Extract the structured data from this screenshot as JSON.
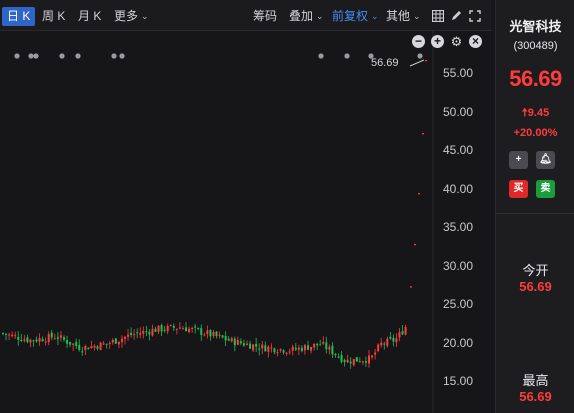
{
  "toolbar": {
    "tabs": [
      "日 K",
      "周 K",
      "月 K"
    ],
    "more": "更多",
    "chips": "筹码",
    "overlay": "叠加",
    "adjust": "前复权",
    "other": "其他"
  },
  "chart": {
    "current_price_tag": "56.69",
    "y_axis_labels": [
      "55.00",
      "50.00",
      "45.00",
      "40.00",
      "35.00",
      "30.00",
      "25.00",
      "20.00",
      "15.00"
    ],
    "colors": {
      "up": "#ff3b3b",
      "down": "#1fbf54",
      "background": "#161618"
    }
  },
  "chart_data": {
    "type": "candlestick",
    "ylim": [
      13,
      57
    ],
    "y_ticks": [
      55,
      50,
      45,
      40,
      35,
      30,
      25,
      20,
      15
    ],
    "last_close": 56.69,
    "recent_limit_up_closes": [
      27.3,
      32.8,
      39.4,
      47.2,
      56.69
    ]
  },
  "stock": {
    "name": "光智科技",
    "code": "(300489)",
    "price": "56.69",
    "change": "9.45",
    "change_pct": "+20.00%",
    "buy_label": "买",
    "sell_label": "卖",
    "open_label": "今开",
    "open_value": "56.69",
    "high_label": "最高",
    "high_value": "56.69"
  }
}
